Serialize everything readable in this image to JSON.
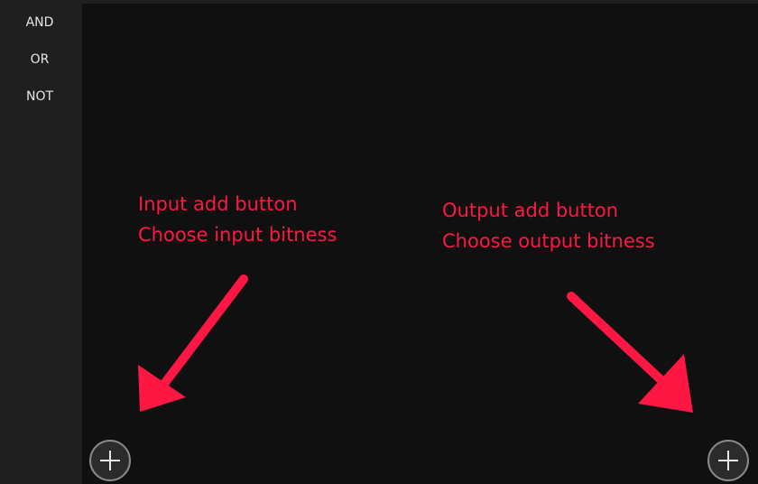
{
  "sidebar": {
    "items": [
      {
        "label": "AND"
      },
      {
        "label": "OR"
      },
      {
        "label": "NOT"
      }
    ]
  },
  "annotations": {
    "input": {
      "line1": "Input add button",
      "line2": "Choose input bitness"
    },
    "output": {
      "line1": "Output add button",
      "line2": "Choose output bitness"
    }
  },
  "buttons": {
    "input_add_icon": "plus-icon",
    "output_add_icon": "plus-icon"
  },
  "colors": {
    "annotation": "#ff1744",
    "canvas_background": "#101010",
    "sidebar_background": "#1f1f1f",
    "button_border": "#8a8a8a"
  }
}
